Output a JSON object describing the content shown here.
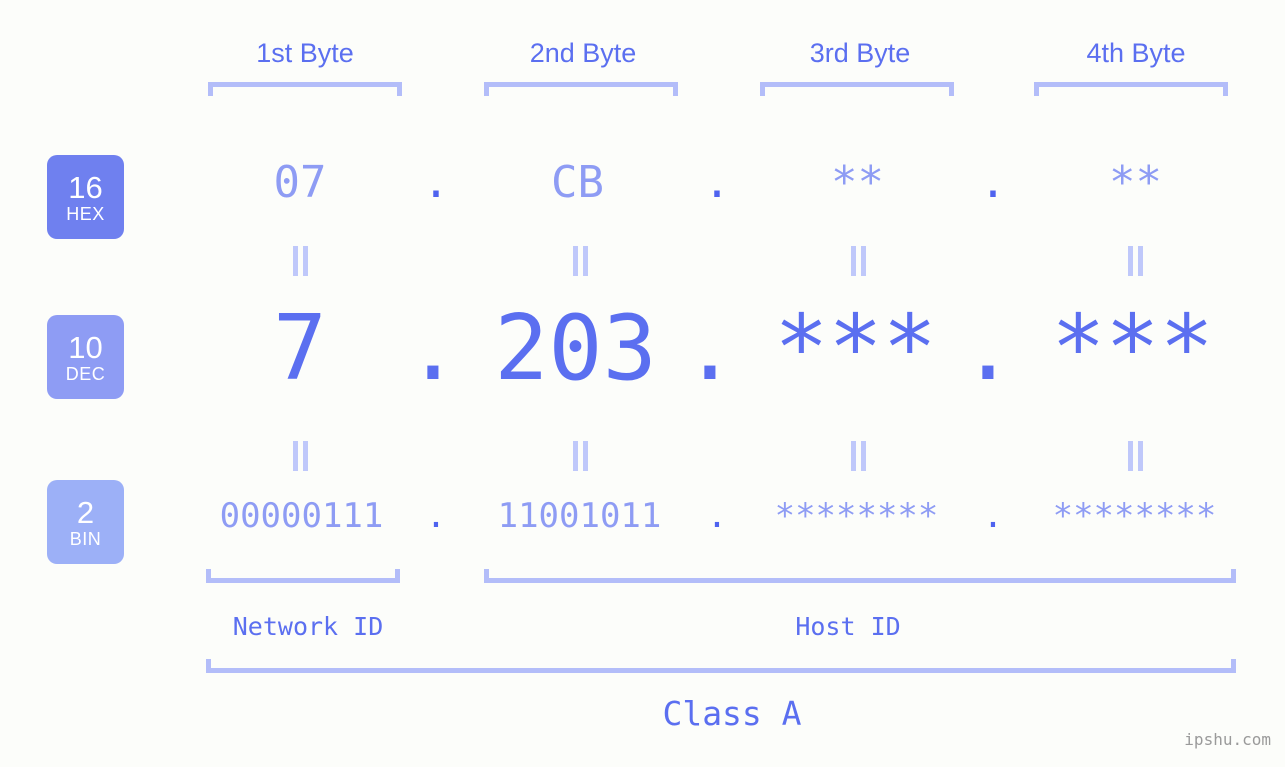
{
  "page": {
    "background_color": "#fcfdfa",
    "accent_color": "#5b6ff0",
    "accent_light_color": "#8e9cf4",
    "bracket_color": "#b3bdf9",
    "watermark": "ipshu.com"
  },
  "byte_headers": [
    {
      "label": "1st Byte"
    },
    {
      "label": "2nd Byte"
    },
    {
      "label": "3rd Byte"
    },
    {
      "label": "4th Byte"
    }
  ],
  "bases": [
    {
      "number": "16",
      "name": "HEX",
      "color": "#6f80ef"
    },
    {
      "number": "10",
      "name": "DEC",
      "color": "#8e9cf4"
    },
    {
      "number": "2",
      "name": "BIN",
      "color": "#9cb0f7"
    }
  ],
  "rows": {
    "hex": {
      "base": "16",
      "base_name": "HEX",
      "values": [
        "07",
        "CB",
        "**",
        "**"
      ],
      "separator": "."
    },
    "dec": {
      "base": "10",
      "base_name": "DEC",
      "values": [
        "7",
        "203",
        "***",
        "***"
      ],
      "separator": "."
    },
    "bin": {
      "base": "2",
      "base_name": "BIN",
      "values": [
        "00000111",
        "11001011",
        "********",
        "********"
      ],
      "separator": "."
    }
  },
  "equality_marks": {
    "glyph": "=",
    "count_per_gap": 4,
    "gaps": 2
  },
  "id_labels": [
    {
      "label": "Network ID"
    },
    {
      "label": "Host ID"
    }
  ],
  "class_label": {
    "label": "Class A"
  }
}
